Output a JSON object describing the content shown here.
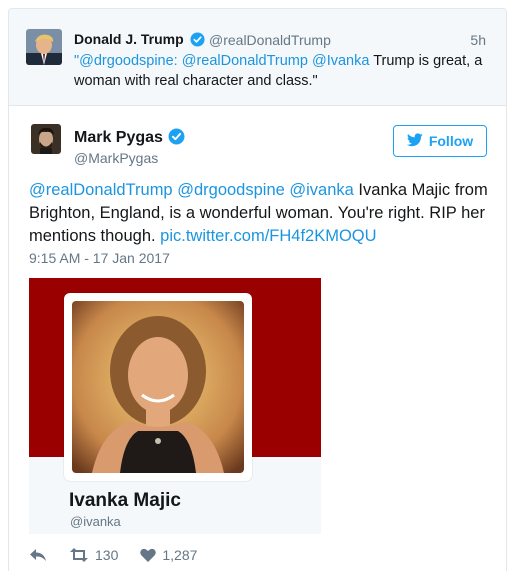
{
  "quoted_tweet": {
    "author_name": "Donald J. Trump",
    "author_handle": "@realDonaldTrump",
    "time": "5h",
    "text_mention_1": "\"@drgoodspine:",
    "text_mention_2": "@realDonaldTrump",
    "text_mention_3": "@Ivanka",
    "text_rest": " Trump is great, a woman with real character and class.\""
  },
  "tweet": {
    "author_name": "Mark Pygas",
    "author_handle": "@MarkPygas",
    "follow_label": "Follow",
    "mention_1": "@realDonaldTrump",
    "mention_2": "@drgoodspine",
    "mention_3": "@ivanka",
    "body": " Ivanka Majic from Brighton, England, is a wonderful woman. You're right. RIP her mentions though. ",
    "link": "pic.twitter.com/FH4f2KMOQU",
    "timestamp": "9:15 AM - 17 Jan 2017"
  },
  "media_card": {
    "name": "Ivanka Majic",
    "handle": "@ivanka",
    "banner_color": "#9b0000"
  },
  "actions": {
    "reply_icon": "reply-icon",
    "retweet_icon": "retweet-icon",
    "retweet_count": "130",
    "like_icon": "heart-icon",
    "like_count": "1,287"
  },
  "colors": {
    "link": "#1b95e0",
    "accent": "#1da1f2",
    "secondary_text": "#657786"
  }
}
